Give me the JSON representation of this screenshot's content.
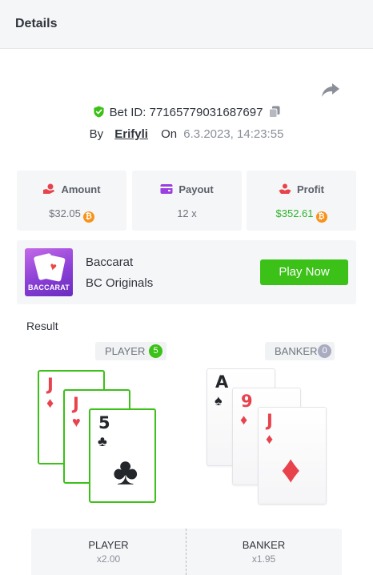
{
  "header": {
    "title": "Details"
  },
  "bet": {
    "id_text": "Bet ID: 77165779031687697",
    "by_label": "By",
    "username": "Erifyli",
    "on_label": "On",
    "date": "6.3.2023, 14:23:55"
  },
  "stats": {
    "amount": {
      "label": "Amount",
      "value": "$32.05",
      "icon": "dollar-hand-icon"
    },
    "payout": {
      "label": "Payout",
      "value": "12 x",
      "icon": "wallet-icon"
    },
    "profit": {
      "label": "Profit",
      "value": "$352.61",
      "icon": "profit-hand-icon"
    },
    "coin_symbol": "₿"
  },
  "game": {
    "thumb_label": "BACCARAT",
    "name": "Baccarat",
    "provider": "BC Originals",
    "play_label": "Play Now"
  },
  "result": {
    "label": "Result",
    "player": {
      "label": "PLAYER",
      "score": "5"
    },
    "banker": {
      "label": "BANKER",
      "score": "0"
    },
    "player_cards": [
      {
        "rank": "J",
        "suit": "♦"
      },
      {
        "rank": "J",
        "suit": "♥"
      },
      {
        "rank": "5",
        "suit": "♣"
      }
    ],
    "banker_cards": [
      {
        "rank": "A",
        "suit": "♠"
      },
      {
        "rank": "9",
        "suit": "♦"
      },
      {
        "rank": "J",
        "suit": "♦"
      }
    ]
  },
  "bets": {
    "player": {
      "label": "PLAYER",
      "odds": "x2.00"
    },
    "banker": {
      "label": "BANKER",
      "odds": "x1.95"
    }
  },
  "colors": {
    "accent_green": "#3bc117",
    "red_suit": "#e8434d",
    "coin": "#f7931a",
    "banker_badge": "#a9acc0"
  }
}
